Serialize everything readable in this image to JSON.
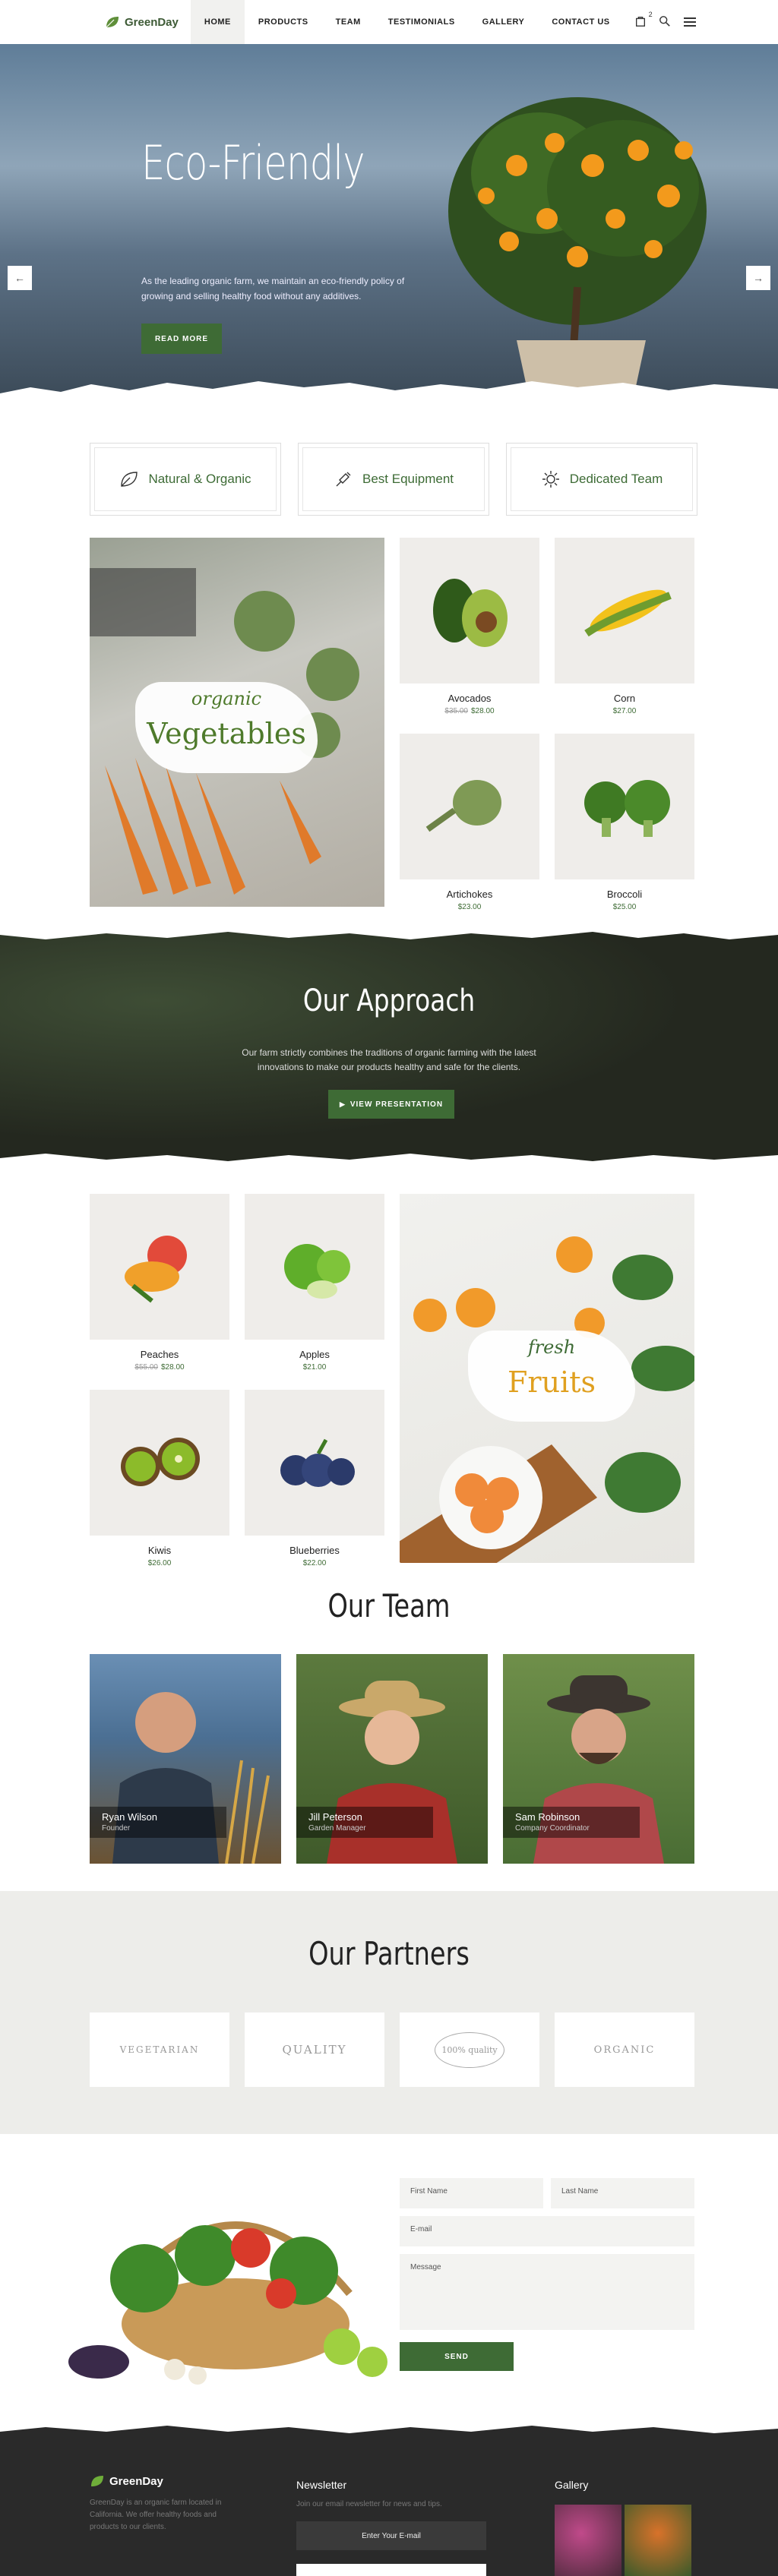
{
  "brand": {
    "name": "GreenDay",
    "accent": "#3e6b35"
  },
  "nav": {
    "items": [
      "HOME",
      "PRODUCTS",
      "TEAM",
      "TESTIMONIALS",
      "GALLERY",
      "CONTACT US"
    ],
    "cart_count": "2"
  },
  "hero": {
    "title": "Eco-Friendly",
    "text": "As the leading organic farm, we maintain an eco-friendly policy of growing and selling healthy food without any additives.",
    "button": "READ MORE"
  },
  "features": [
    "Natural & Organic",
    "Best Equipment",
    "Dedicated Team"
  ],
  "vegetables": {
    "banner_small": "organic",
    "banner_big": "Vegetables",
    "products": [
      {
        "name": "Avocados",
        "old_price": "$35.00",
        "price": "$28.00"
      },
      {
        "name": "Corn",
        "old_price": "",
        "price": "$27.00"
      },
      {
        "name": "Artichokes",
        "old_price": "",
        "price": "$23.00"
      },
      {
        "name": "Broccoli",
        "old_price": "",
        "price": "$25.00"
      }
    ]
  },
  "approach": {
    "title": "Our Approach",
    "text": "Our farm strictly combines the traditions of organic farming with the latest innovations to make our products healthy and safe for the clients.",
    "button": "VIEW PRESENTATION"
  },
  "fruits": {
    "banner_small": "fresh",
    "banner_big": "Fruits",
    "products": [
      {
        "name": "Peaches",
        "old_price": "$55.00",
        "price": "$28.00"
      },
      {
        "name": "Apples",
        "old_price": "",
        "price": "$21.00"
      },
      {
        "name": "Kiwis",
        "old_price": "",
        "price": "$26.00"
      },
      {
        "name": "Blueberries",
        "old_price": "",
        "price": "$22.00"
      }
    ]
  },
  "team": {
    "title": "Our Team",
    "members": [
      {
        "name": "Ryan Wilson",
        "role": "Founder"
      },
      {
        "name": "Jill Peterson",
        "role": "Garden Manager"
      },
      {
        "name": "Sam Robinson",
        "role": "Company Coordinator"
      }
    ]
  },
  "partners": {
    "title": "Our Partners",
    "logos": [
      "VEGETARIAN",
      "QUALITY",
      "100% quality",
      "ORGANIC"
    ]
  },
  "contact": {
    "first_name": "First Name",
    "last_name": "Last Name",
    "email": "E-mail",
    "message": "Message",
    "button": "SEND"
  },
  "footer": {
    "about": "GreenDay is an organic farm located in California. We offer healthy foods and products to our clients.",
    "newsletter_title": "Newsletter",
    "newsletter_text": "Join our email newsletter for news and tips.",
    "email_placeholder": "Enter Your E-mail",
    "gallery_title": "Gallery"
  }
}
